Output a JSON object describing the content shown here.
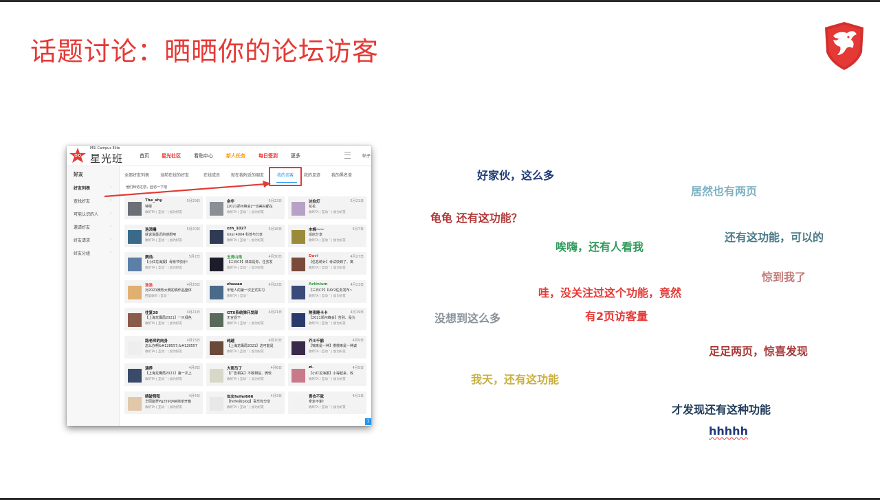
{
  "slide": {
    "title": "话题讨论：晒晒你的论坛访客"
  },
  "screenshot": {
    "brand": {
      "subtitle": "MSI Campus Elite",
      "name": "星光班"
    },
    "nav": [
      {
        "label": "首页",
        "style": "plain"
      },
      {
        "label": "星光社区",
        "style": "red"
      },
      {
        "label": "看贴中心",
        "style": "plain"
      },
      {
        "label": "新人任务",
        "style": "orange"
      },
      {
        "label": "每日签到",
        "style": "red"
      },
      {
        "label": "更多",
        "style": "plain"
      }
    ],
    "nav_post": "帖子",
    "sidebar": {
      "title": "好友",
      "items": [
        {
          "label": "好友列表",
          "active": true
        },
        {
          "label": "查找好友"
        },
        {
          "label": "可能认识的人"
        },
        {
          "label": "邀请好友"
        },
        {
          "label": "好友请求"
        },
        {
          "label": "好友分组"
        }
      ]
    },
    "tabs": [
      {
        "label": "全部好友列表"
      },
      {
        "label": "当前在线的好友"
      },
      {
        "label": "在线成员"
      },
      {
        "label": "就在我附近的朋友"
      },
      {
        "label": "我的访客",
        "active": true
      },
      {
        "label": "我的足迹"
      },
      {
        "label": "我的黑名单"
      }
    ],
    "visitor_hint": "他们拜访过您，回访一下吧",
    "cards": [
      {
        "name": "The_shy",
        "date": "5月29日",
        "desc": "钟楼",
        "actions": "收听TA | 互动 ˅ | 加为好友",
        "avatar": "#6b6f78",
        "name_color": "plain"
      },
      {
        "name": "余华",
        "date": "5月22日",
        "desc": "[2021郑州峰会]一切美好都在",
        "actions": "收听TA | 互动 ˅ | 加为好友",
        "avatar": "#8a8f96",
        "name_color": "plain"
      },
      {
        "name": "达伯灯",
        "date": "5月21日",
        "desc": "花花",
        "actions": "收听TA | 互动 ˅ | 加为好友",
        "avatar": "#b7a2c7",
        "name_color": "plain"
      },
      {
        "name": "洛须曦",
        "date": "5月20日",
        "desc": "就说说最近的感想吧",
        "actions": "收听TA | 互动 ˅ | 加为好友",
        "avatar": "#3a6a8a",
        "name_color": "plain"
      },
      {
        "name": "zzh_1027",
        "date": "5月16日",
        "desc": "Intel 4004 科普与分享",
        "actions": "收听TA | 互动 ˅ | 加为好友",
        "avatar": "#2f3b55",
        "name_color": "plain"
      },
      {
        "name": "木棉～～",
        "date": "5月7日",
        "desc": "巡店分享",
        "actions": "收听TA | 互动 ˅ | 加为好友",
        "avatar": "#9a8a3a",
        "name_color": "plain"
      },
      {
        "name": "搁浅.",
        "date": "5月2日",
        "desc": "【小红龙海报】母亲节快乐!",
        "actions": "收听TA | 互动 ˅ | 加为好友",
        "avatar": "#5b7fa6",
        "name_color": "plain"
      },
      {
        "name": "玉清山雨",
        "date": "4月30日",
        "desc": "【三日CP】锦来是你、任务发",
        "actions": "收听TA | 互动 ˅ | 加为好友",
        "avatar": "#1c1c2a",
        "name_color": "green"
      },
      {
        "name": "Davi",
        "date": "4月27日",
        "desc": "【信息统计】考试快到了、离",
        "actions": "收听TA | 互动 ˅ | 加为好友",
        "avatar": "#7a4a3a",
        "name_color": "red"
      },
      {
        "name": "渔渔",
        "date": "4月26日",
        "desc": "对2021微软大赛初稿作品整体",
        "actions": "回复收听 | 互动 ˅",
        "avatar": "#e0b070",
        "name_color": "red"
      },
      {
        "name": "zhuuao",
        "date": "4月22日",
        "desc": "年轻人的第一次正式实习",
        "actions": "收听TA | 互动 ˅",
        "avatar": "#4a6a8a",
        "name_color": "plain"
      },
      {
        "name": "Actinium",
        "date": "4月21日",
        "desc": "【三日CP】DAY2任务发布~",
        "actions": "收听TA | 互动 ˅ | 加为好友",
        "avatar": "#3a4a7a",
        "name_color": "green"
      },
      {
        "name": "往复28",
        "date": "4月21日",
        "desc": "【上海龙鹰局2021】一只绿色",
        "actions": "收听TA | 互动 ˅ | 加为好友",
        "avatar": "#8a5a4a",
        "name_color": "plain"
      },
      {
        "name": "GTX系统弹开发部",
        "date": "4月21日",
        "desc": "无言捉下",
        "actions": "收听TA | 互动 ˅ | 加为好友",
        "avatar": "#5a6a5a",
        "name_color": "plain"
      },
      {
        "name": "熬夜睡卡卡",
        "date": "4月19日",
        "desc": "【2021郑州峰会】告别、是为",
        "actions": "收听TA | 互动 ˅ | 加为好友",
        "avatar": "#2a3a6a",
        "name_color": "plain"
      },
      {
        "name": "路老师的肉身",
        "date": "4月15日",
        "desc": "怎么办啊&#128557;&#128557",
        "actions": "收听TA | 互动 ˅ | 加为好友",
        "avatar": "#eeeeee",
        "name_color": "plain"
      },
      {
        "name": "纯越",
        "date": "4月10日",
        "desc": "【上海龙鹰局2021】这可能是",
        "actions": "收听TA | 互动 ˅ | 加为好友",
        "avatar": "#6a4a3a",
        "name_color": "plain"
      },
      {
        "name": "芥川千鹤",
        "date": "4月9日",
        "desc": "【锦来是一种】慢慢来是一种诚",
        "actions": "收听TA | 互动 ˅ | 加为好友",
        "avatar": "#3a2a4a",
        "name_color": "plain"
      },
      {
        "name": "涵养",
        "date": "4月8日",
        "desc": "【上海龙鹰局2021】第一次上",
        "actions": "收听TA | 互动 ˅ | 加为好友",
        "avatar": "#3a4a6a",
        "name_color": "plain"
      },
      {
        "name": "大雨马丁",
        "date": "4月6日",
        "desc": "【广告相关】不敢相信、微软",
        "actions": "收听TA | 互动 ˅ | 加为好友",
        "avatar": "#d8d8c8",
        "name_color": "plain"
      },
      {
        "name": "zi.",
        "date": "4月5日",
        "desc": "【小红龙海报】小得起来、收",
        "actions": "收听TA | 互动 ˅ | 加为好友",
        "avatar": "#c87a8a",
        "name_color": "plain"
      },
      {
        "name": "晴破预阳",
        "date": "4月4日",
        "desc": "华硕能罗Pg259QNR简单开箱",
        "actions": "收听TA | 互动 ˅ | 加为好友",
        "avatar": "#e0c8a8",
        "name_color": "plain"
      },
      {
        "name": "似女feifei666",
        "date": "4月3日",
        "desc": "【feifei的plog】喜乐有分享",
        "actions": "收听TA | 互动 ˅ | 加为好友",
        "avatar": "#e8e8e8",
        "name_color": "plain"
      },
      {
        "name": "青衣不就",
        "date": "4月1日",
        "desc": "拿走不谢!",
        "actions": "收听TA | 互动 ˅ | 加为好友",
        "avatar": "#f2f2f2",
        "name_color": "plain"
      }
    ],
    "page_number": "1"
  },
  "comments": [
    {
      "text": "好家伙，这么多",
      "color": "#1e3a78"
    },
    {
      "text": "居然也有两页",
      "color": "#7fb2c2"
    },
    {
      "text": "龟龟 还有这功能？",
      "color": "#b23a3a"
    },
    {
      "text": "唉嗨，还有人看我",
      "color": "#2e9a5a"
    },
    {
      "text": "还有这功能，可以的",
      "color": "#4a7a88"
    },
    {
      "text": "惊到我了",
      "color": "#c07a78"
    },
    {
      "text": "哇，没关注过这个功能，竟然",
      "color": "#e53935"
    },
    {
      "text": "有2页访客量",
      "color": "#e53935"
    },
    {
      "text": "没想到这么多",
      "color": "#8a949c"
    },
    {
      "text": "足足两页，惊喜发现",
      "color": "#a83a3a"
    },
    {
      "text": "我天，还有这功能",
      "color": "#c8b040"
    },
    {
      "text": "才发现还有这种功能",
      "color": "#1e3a58"
    },
    {
      "text": "hhhhh",
      "color": "#1e3a78"
    }
  ],
  "colors": {
    "accent": "#e53935",
    "link_blue": "#2196f3"
  }
}
